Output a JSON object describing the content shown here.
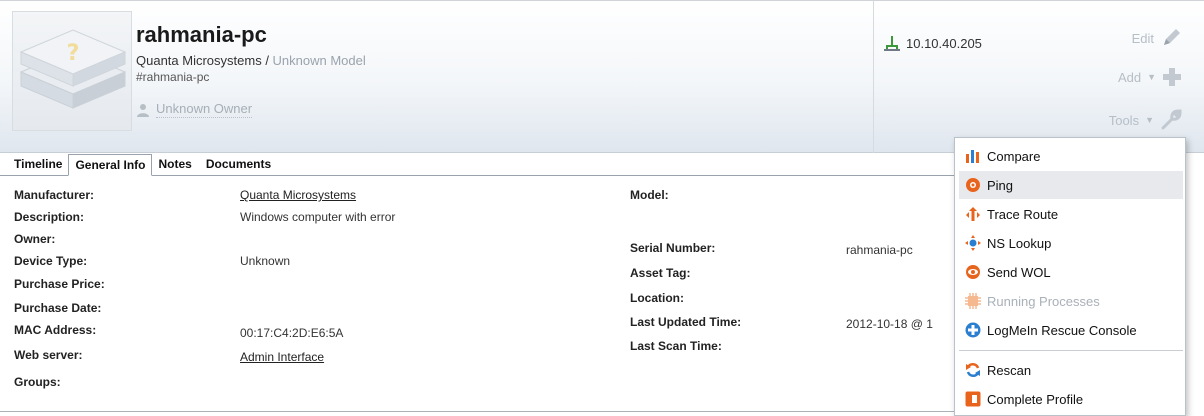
{
  "device": {
    "name": "rahmania-pc",
    "manufacturer": "Quanta Microsystems",
    "separator": " / ",
    "model": "Unknown Model",
    "tag": "#rahmania-pc",
    "owner": "Unknown Owner",
    "ip": "10.10.40.205"
  },
  "actions": {
    "edit": "Edit",
    "add": "Add",
    "tools": "Tools"
  },
  "tabs": [
    "Timeline",
    "General Info",
    "Notes",
    "Documents"
  ],
  "active_tab": "General Info",
  "details_left": [
    {
      "label": "Manufacturer:",
      "value": "Quanta Microsystems",
      "link": true
    },
    {
      "label": "Description:",
      "value": "Windows computer with error"
    },
    {
      "label": "Owner:",
      "value": ""
    },
    {
      "label": "Device Type:",
      "value": "Unknown"
    },
    {
      "label": "Purchase Price:",
      "value": ""
    },
    {
      "label": "Purchase Date:",
      "value": ""
    },
    {
      "label": "MAC Address:",
      "value": "00:17:C4:2D:E6:5A"
    },
    {
      "label": "Web server:",
      "value": "Admin Interface",
      "link": true
    },
    {
      "label": "Groups:",
      "value": ""
    }
  ],
  "details_right": [
    {
      "label": "Model:",
      "value": ""
    },
    {
      "label": "Serial Number:",
      "value": "rahmania-pc"
    },
    {
      "label": "Asset Tag:",
      "value": ""
    },
    {
      "label": "Location:",
      "value": ""
    },
    {
      "label": "Last Updated Time:",
      "value": "2012-10-18 @ 1"
    },
    {
      "label": "Last Scan Time:",
      "value": ""
    }
  ],
  "tools_menu": [
    {
      "label": "Compare",
      "icon": "compare-icon",
      "color": "#e8641c"
    },
    {
      "label": "Ping",
      "icon": "ping-icon",
      "color": "#e8641c",
      "highlighted": true
    },
    {
      "label": "Trace Route",
      "icon": "trace-route-icon",
      "color": "#e8641c"
    },
    {
      "label": "NS Lookup",
      "icon": "ns-lookup-icon",
      "color": "#e8641c"
    },
    {
      "label": "Send WOL",
      "icon": "send-wol-icon",
      "color": "#e8641c"
    },
    {
      "label": "Running Processes",
      "icon": "running-processes-icon",
      "color": "#f2a97a",
      "disabled": true
    },
    {
      "label": "LogMeIn Rescue Console",
      "icon": "logmein-icon",
      "color": "#2b7fd0"
    },
    {
      "label": "Rescan",
      "icon": "rescan-icon",
      "color": "#e8641c"
    },
    {
      "label": "Complete Profile",
      "icon": "complete-profile-icon",
      "color": "#e8641c"
    }
  ],
  "colors": {
    "accent": "#e8641c",
    "muted_text": "#9aa3ad",
    "menu_highlight": "#e7e9ec"
  }
}
